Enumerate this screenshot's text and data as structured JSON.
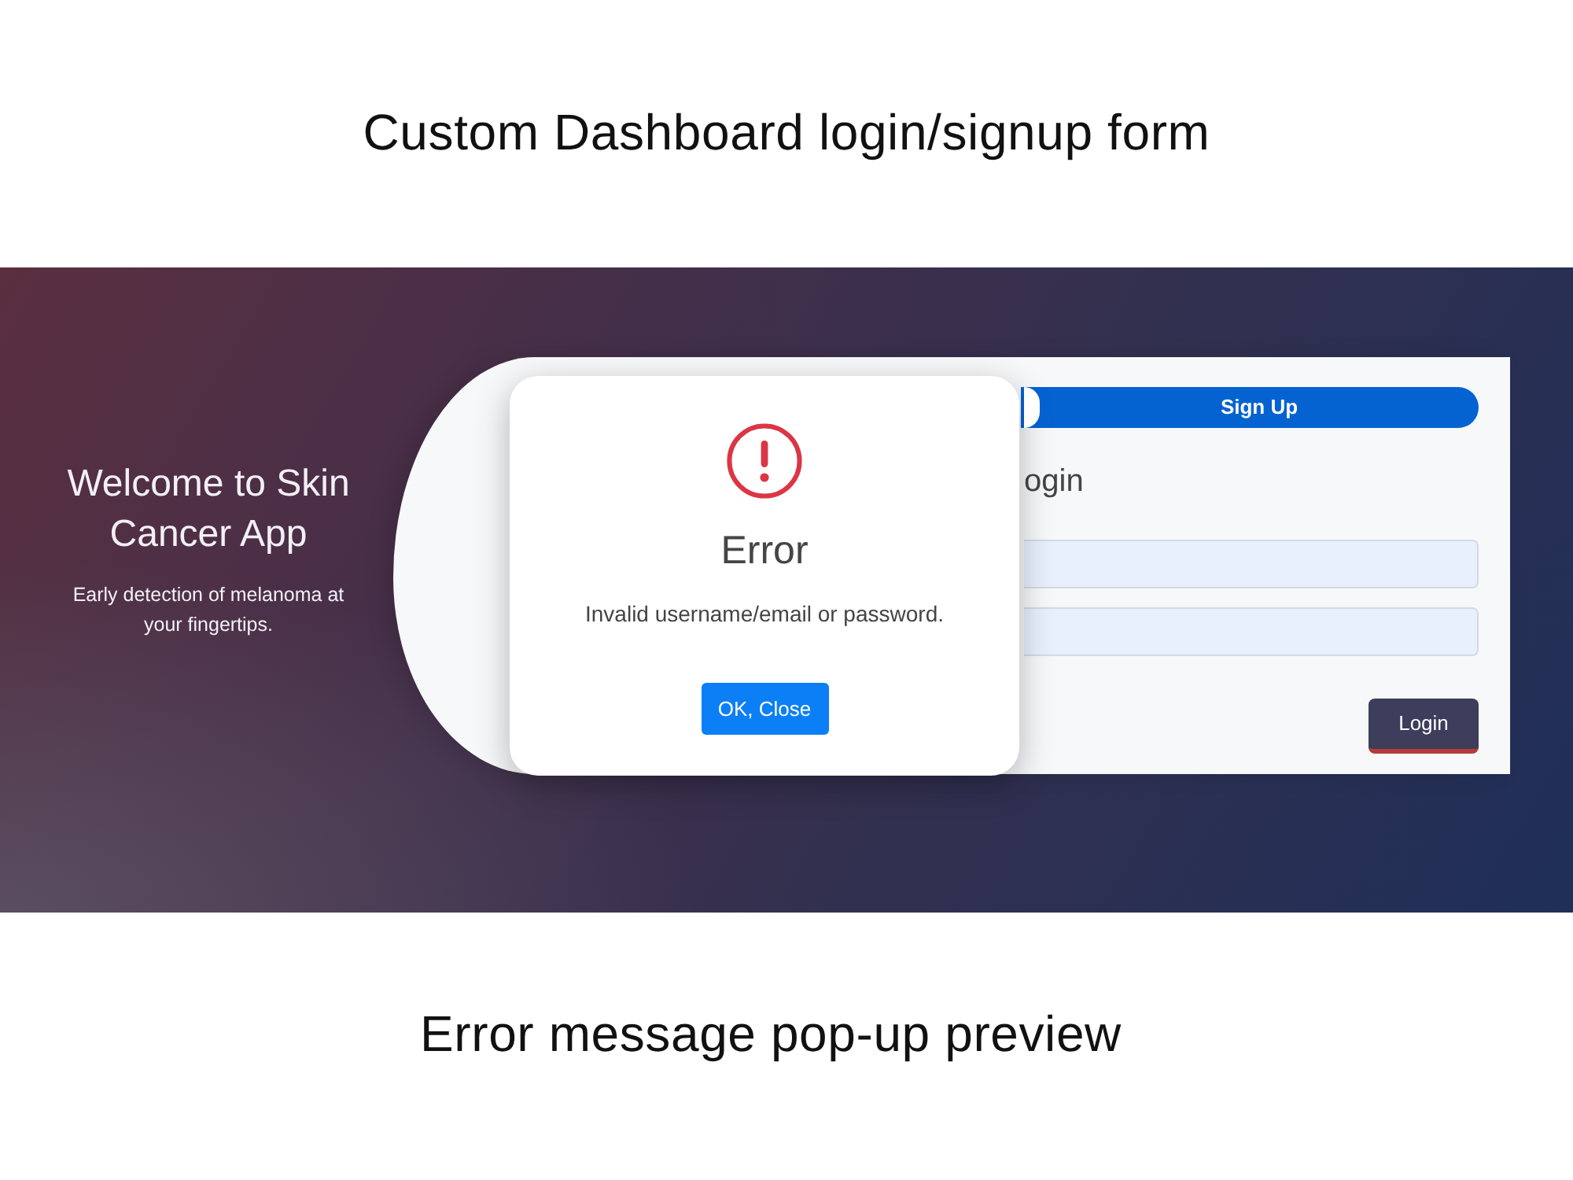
{
  "heading": "Custom Dashboard login/signup form",
  "banner": {
    "welcome": {
      "title": "Welcome to Skin Cancer App",
      "subtitle": "Early detection of melanoma at your fingertips."
    },
    "form": {
      "tabs": [
        {
          "selected": true
        },
        {
          "label": "Sign Up",
          "selected": false
        }
      ],
      "title": "ogin",
      "fields": [
        {
          "autofilled": true
        },
        {
          "autofilled": true
        }
      ],
      "submit": "Login"
    },
    "dialog": {
      "error": true,
      "title": "Error",
      "message": "Invalid username/email or password.",
      "button": "OK, Close"
    }
  },
  "caption": "Error message pop-up preview"
}
